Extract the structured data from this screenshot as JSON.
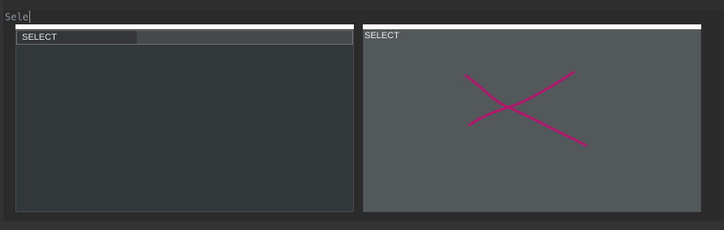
{
  "editor": {
    "typed_text": "Sele"
  },
  "completion_popup": {
    "items": [
      {
        "label": "SELECT",
        "selected": true
      }
    ]
  },
  "documentation_popup": {
    "title": "SELECT",
    "mark_icon": "cross-scribble-icon",
    "mark_color": "#b3176d"
  }
}
